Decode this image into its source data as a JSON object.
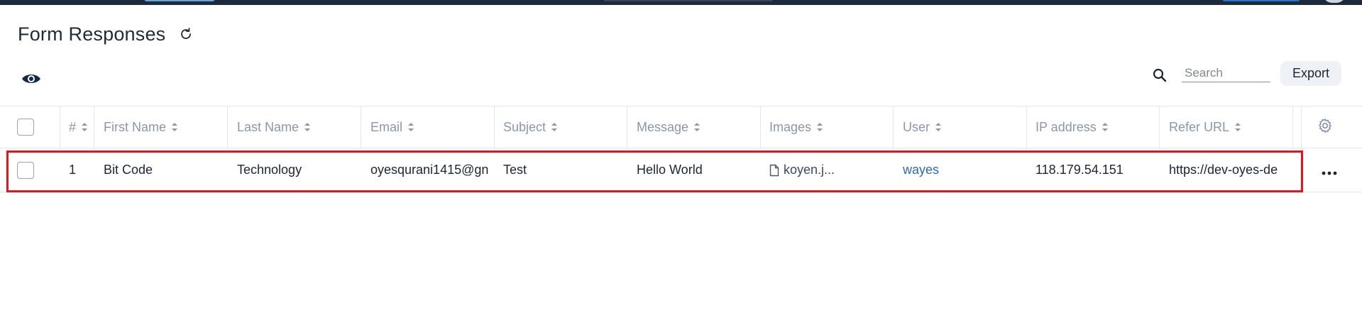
{
  "page": {
    "title": "Form Responses"
  },
  "toolbar": {
    "search_placeholder": "Search",
    "export_label": "Export"
  },
  "table": {
    "columns": [
      "#",
      "First Name",
      "Last Name",
      "Email",
      "Subject",
      "Message",
      "Images",
      "User",
      "IP address",
      "Refer URL"
    ],
    "rows": [
      {
        "number": "1",
        "first_name": "Bit Code",
        "last_name": "Technology",
        "email": "oyesqurani1415@gn",
        "subject": "Test",
        "message": "Hello World",
        "image": "koyen.j...",
        "user": "wayes",
        "ip": "118.179.54.151",
        "refer_url": "https://dev-oyes-de"
      }
    ]
  },
  "icons": {
    "refresh": "refresh-icon",
    "visibility": "eye-icon",
    "search": "search-icon",
    "settings": "gear-icon",
    "row_actions": "more-horizontal-icon",
    "file": "file-icon",
    "sort": "sort-icon"
  },
  "colors": {
    "highlight": "#e8141b",
    "link": "#2b6bb5",
    "header_text": "#8a97ab",
    "top_bar": "#1c2a3c"
  }
}
